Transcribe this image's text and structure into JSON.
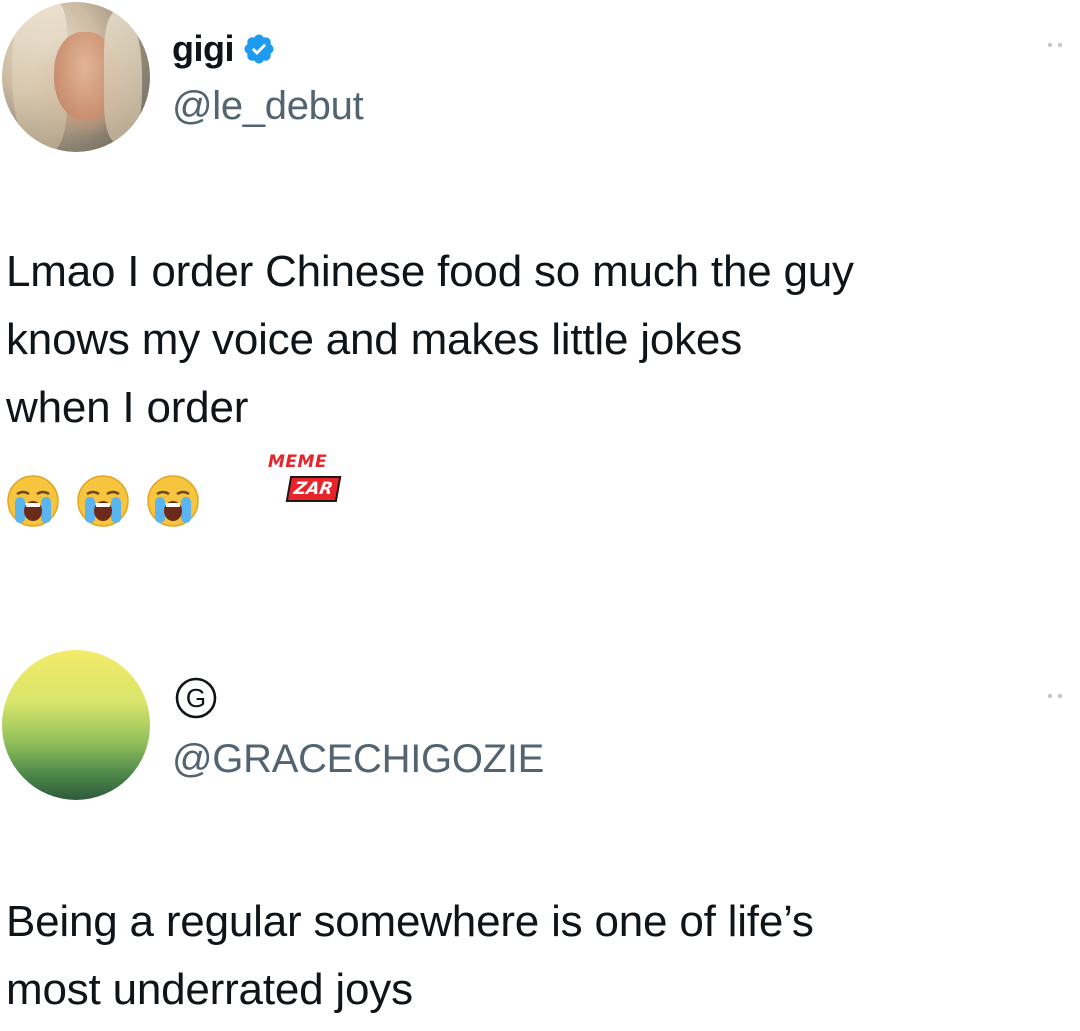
{
  "tweets": [
    {
      "display_name": "gigi",
      "verified": true,
      "handle": "@le_debut",
      "text": "Lmao I order Chinese food so much the guy\nknows my voice and makes little jokes\nwhen I order",
      "emojis": [
        "loudly-crying-face",
        "loudly-crying-face",
        "loudly-crying-face"
      ],
      "watermark": {
        "line1": "MEME",
        "line2": "ZAR"
      }
    },
    {
      "display_name_symbol": "Ⓖ",
      "handle": "@GRACECHIGOZIE",
      "text": "Being a regular somewhere is one of life’s\nmost underrated joys"
    }
  ],
  "colors": {
    "text": "#0f1419",
    "secondary": "#536471",
    "verified": "#1d9bf0",
    "watermark": "#e8232a"
  }
}
